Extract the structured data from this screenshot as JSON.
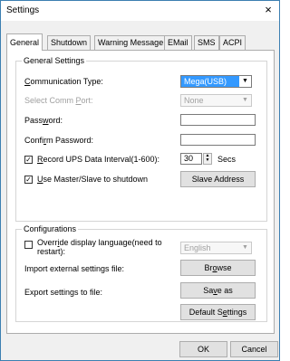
{
  "window": {
    "title": "Settings",
    "close_glyph": "×"
  },
  "tabs": [
    {
      "label": "General"
    },
    {
      "label": "Shutdown"
    },
    {
      "label": "Warning Message"
    },
    {
      "label": "EMail"
    },
    {
      "label": "SMS"
    },
    {
      "label": "ACPI"
    }
  ],
  "general_settings": {
    "legend": "General Settings",
    "comm_type_label": "Communication Type:",
    "comm_type_value": "Mega(USB)",
    "comm_port_label": "Select Comm Port:",
    "comm_port_value": "None",
    "password_label": "Password:",
    "password_value": "",
    "confirm_password_label": "Confirm Password:",
    "confirm_password_value": "",
    "record_interval_label": "Record UPS Data Interval(1-600):",
    "record_interval_checked": true,
    "record_interval_value": "30",
    "record_interval_unit": "Secs",
    "master_slave_label": "Use Master/Slave to shutdown",
    "master_slave_checked": true,
    "slave_address_button": "Slave Address"
  },
  "configurations": {
    "legend": "Configurations",
    "override_label_line1": "Override display language(need to",
    "override_label_line2": "restart):",
    "override_checked": false,
    "language_value": "English",
    "import_label": "Import external settings file:",
    "browse_button": "Browse",
    "export_label": "Export settings to file:",
    "save_as_button": "Save as",
    "default_settings_button": "Default Settings"
  },
  "footer": {
    "ok_button": "OK",
    "cancel_button": "Cancel"
  },
  "icons": {
    "dropdown": "chevron-down-icon",
    "close": "close-icon",
    "check": "checkmark-icon"
  }
}
